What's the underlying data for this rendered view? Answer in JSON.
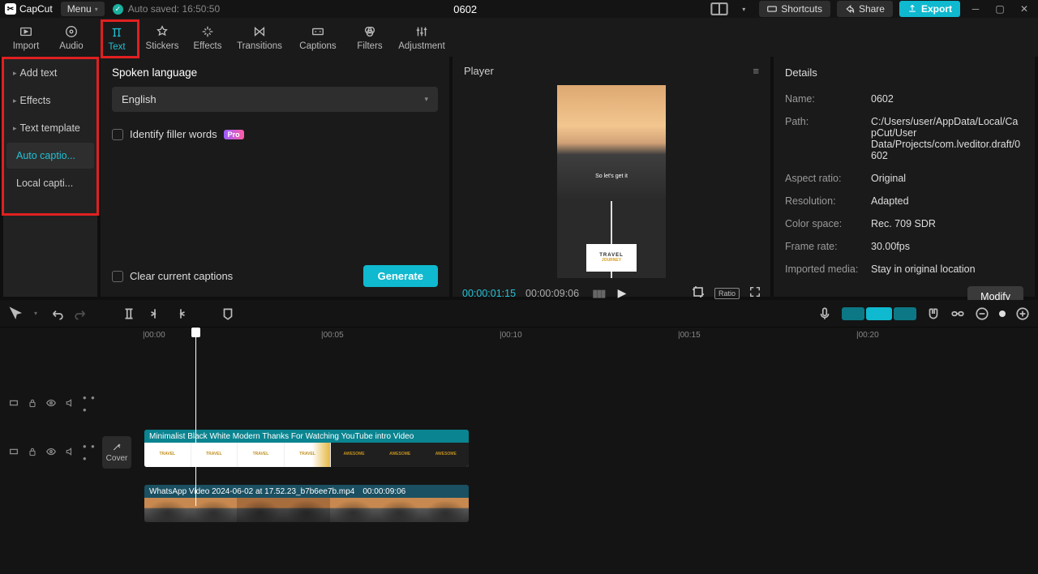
{
  "app": {
    "name": "CapCut"
  },
  "menu": {
    "label": "Menu"
  },
  "autosave": {
    "text": "Auto saved: 16:50:50"
  },
  "project_title": "0602",
  "titlebar_buttons": {
    "shortcuts": "Shortcuts",
    "share": "Share",
    "export": "Export"
  },
  "main_tabs": {
    "import": "Import",
    "audio": "Audio",
    "text": "Text",
    "stickers": "Stickers",
    "effects": "Effects",
    "transitions": "Transitions",
    "captions": "Captions",
    "filters": "Filters",
    "adjustment": "Adjustment"
  },
  "text_sidebar": {
    "add_text": "Add text",
    "effects": "Effects",
    "template": "Text template",
    "auto": "Auto captio...",
    "local": "Local capti..."
  },
  "options": {
    "label": "Spoken language",
    "language": "English",
    "filler": "Identify filler words",
    "pro": "Pro",
    "clear": "Clear current captions",
    "generate": "Generate"
  },
  "player": {
    "title": "Player",
    "overlay_text": "So let's get it",
    "stamp_line1": "TRAVEL",
    "stamp_line2": "JOURNEY",
    "time_current": "00:00:01:15",
    "time_total": "00:00:09:06",
    "ratio": "Ratio"
  },
  "details": {
    "title": "Details",
    "name_k": "Name:",
    "name_v": "0602",
    "path_k": "Path:",
    "path_v": "C:/Users/user/AppData/Local/CapCut/User Data/Projects/com.lveditor.draft/0602",
    "aspect_k": "Aspect ratio:",
    "aspect_v": "Original",
    "res_k": "Resolution:",
    "res_v": "Adapted",
    "color_k": "Color space:",
    "color_v": "Rec. 709 SDR",
    "fps_k": "Frame rate:",
    "fps_v": "30.00fps",
    "media_k": "Imported media:",
    "media_v": "Stay in original location",
    "modify": "Modify"
  },
  "timeline": {
    "cover": "Cover",
    "ticks": [
      "00:00",
      "00:05",
      "00:10",
      "00:15",
      "00:20"
    ],
    "clip1_title": "Minimalist Black White Modern Thanks For Watching YouTube intro Video",
    "clip1_seg": "TRAVEL",
    "clip1_seg2": "AWESOME",
    "clip2_title": "WhatsApp Video 2024-06-02 at 17.52.23_b7b6ee7b.mp4",
    "clip2_time": "00:00:09:06"
  }
}
